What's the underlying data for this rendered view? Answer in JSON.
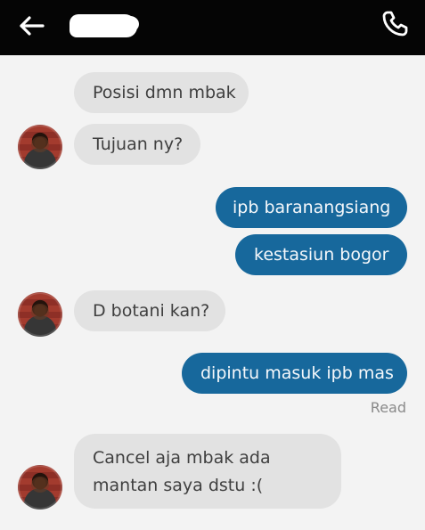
{
  "header": {
    "back_icon": "back-arrow-icon",
    "call_icon": "phone-icon"
  },
  "messages": [
    {
      "direction": "incoming",
      "text": "Posisi dmn mbak"
    },
    {
      "direction": "incoming",
      "text": "Tujuan ny?"
    },
    {
      "direction": "outgoing",
      "text": "ipb baranangsiang"
    },
    {
      "direction": "outgoing",
      "text": "kestasiun bogor"
    },
    {
      "direction": "incoming",
      "text": "D botani kan?"
    },
    {
      "direction": "outgoing",
      "text": "dipintu masuk ipb mas"
    },
    {
      "direction": "incoming",
      "text": "Cancel aja mbak ada mantan saya dstu :("
    }
  ],
  "status": {
    "read_label": "Read"
  },
  "colors": {
    "header_bg": "#050505",
    "chat_bg": "#f3f3f3",
    "incoming_bubble": "#e2e2e2",
    "outgoing_bubble": "#17689c"
  }
}
